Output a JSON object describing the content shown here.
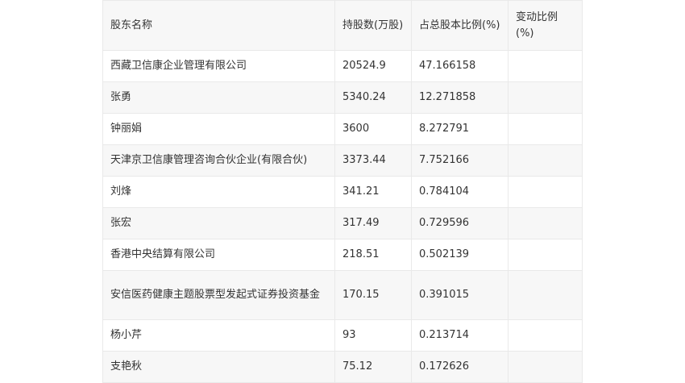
{
  "table": {
    "headers": [
      "股东名称",
      "持股数(万股)",
      "占总股本比例(%)",
      "变动比例(%)"
    ],
    "rows": [
      [
        "西藏卫信康企业管理有限公司",
        "20524.9",
        "47.166158",
        ""
      ],
      [
        "张勇",
        "5340.24",
        "12.271858",
        ""
      ],
      [
        "钟丽娟",
        "3600",
        "8.272791",
        ""
      ],
      [
        "天津京卫信康管理咨询合伙企业(有限合伙)",
        "3373.44",
        "7.752166",
        ""
      ],
      [
        "刘烽",
        "341.21",
        "0.784104",
        ""
      ],
      [
        "张宏",
        "317.49",
        "0.729596",
        ""
      ],
      [
        "香港中央结算有限公司",
        "218.51",
        "0.502139",
        ""
      ],
      [
        "安信医药健康主题股票型发起式证券投资基金",
        "170.15",
        "0.391015",
        ""
      ],
      [
        "杨小芹",
        "93",
        "0.213714",
        ""
      ],
      [
        "支艳秋",
        "75.12",
        "0.172626",
        ""
      ]
    ]
  }
}
